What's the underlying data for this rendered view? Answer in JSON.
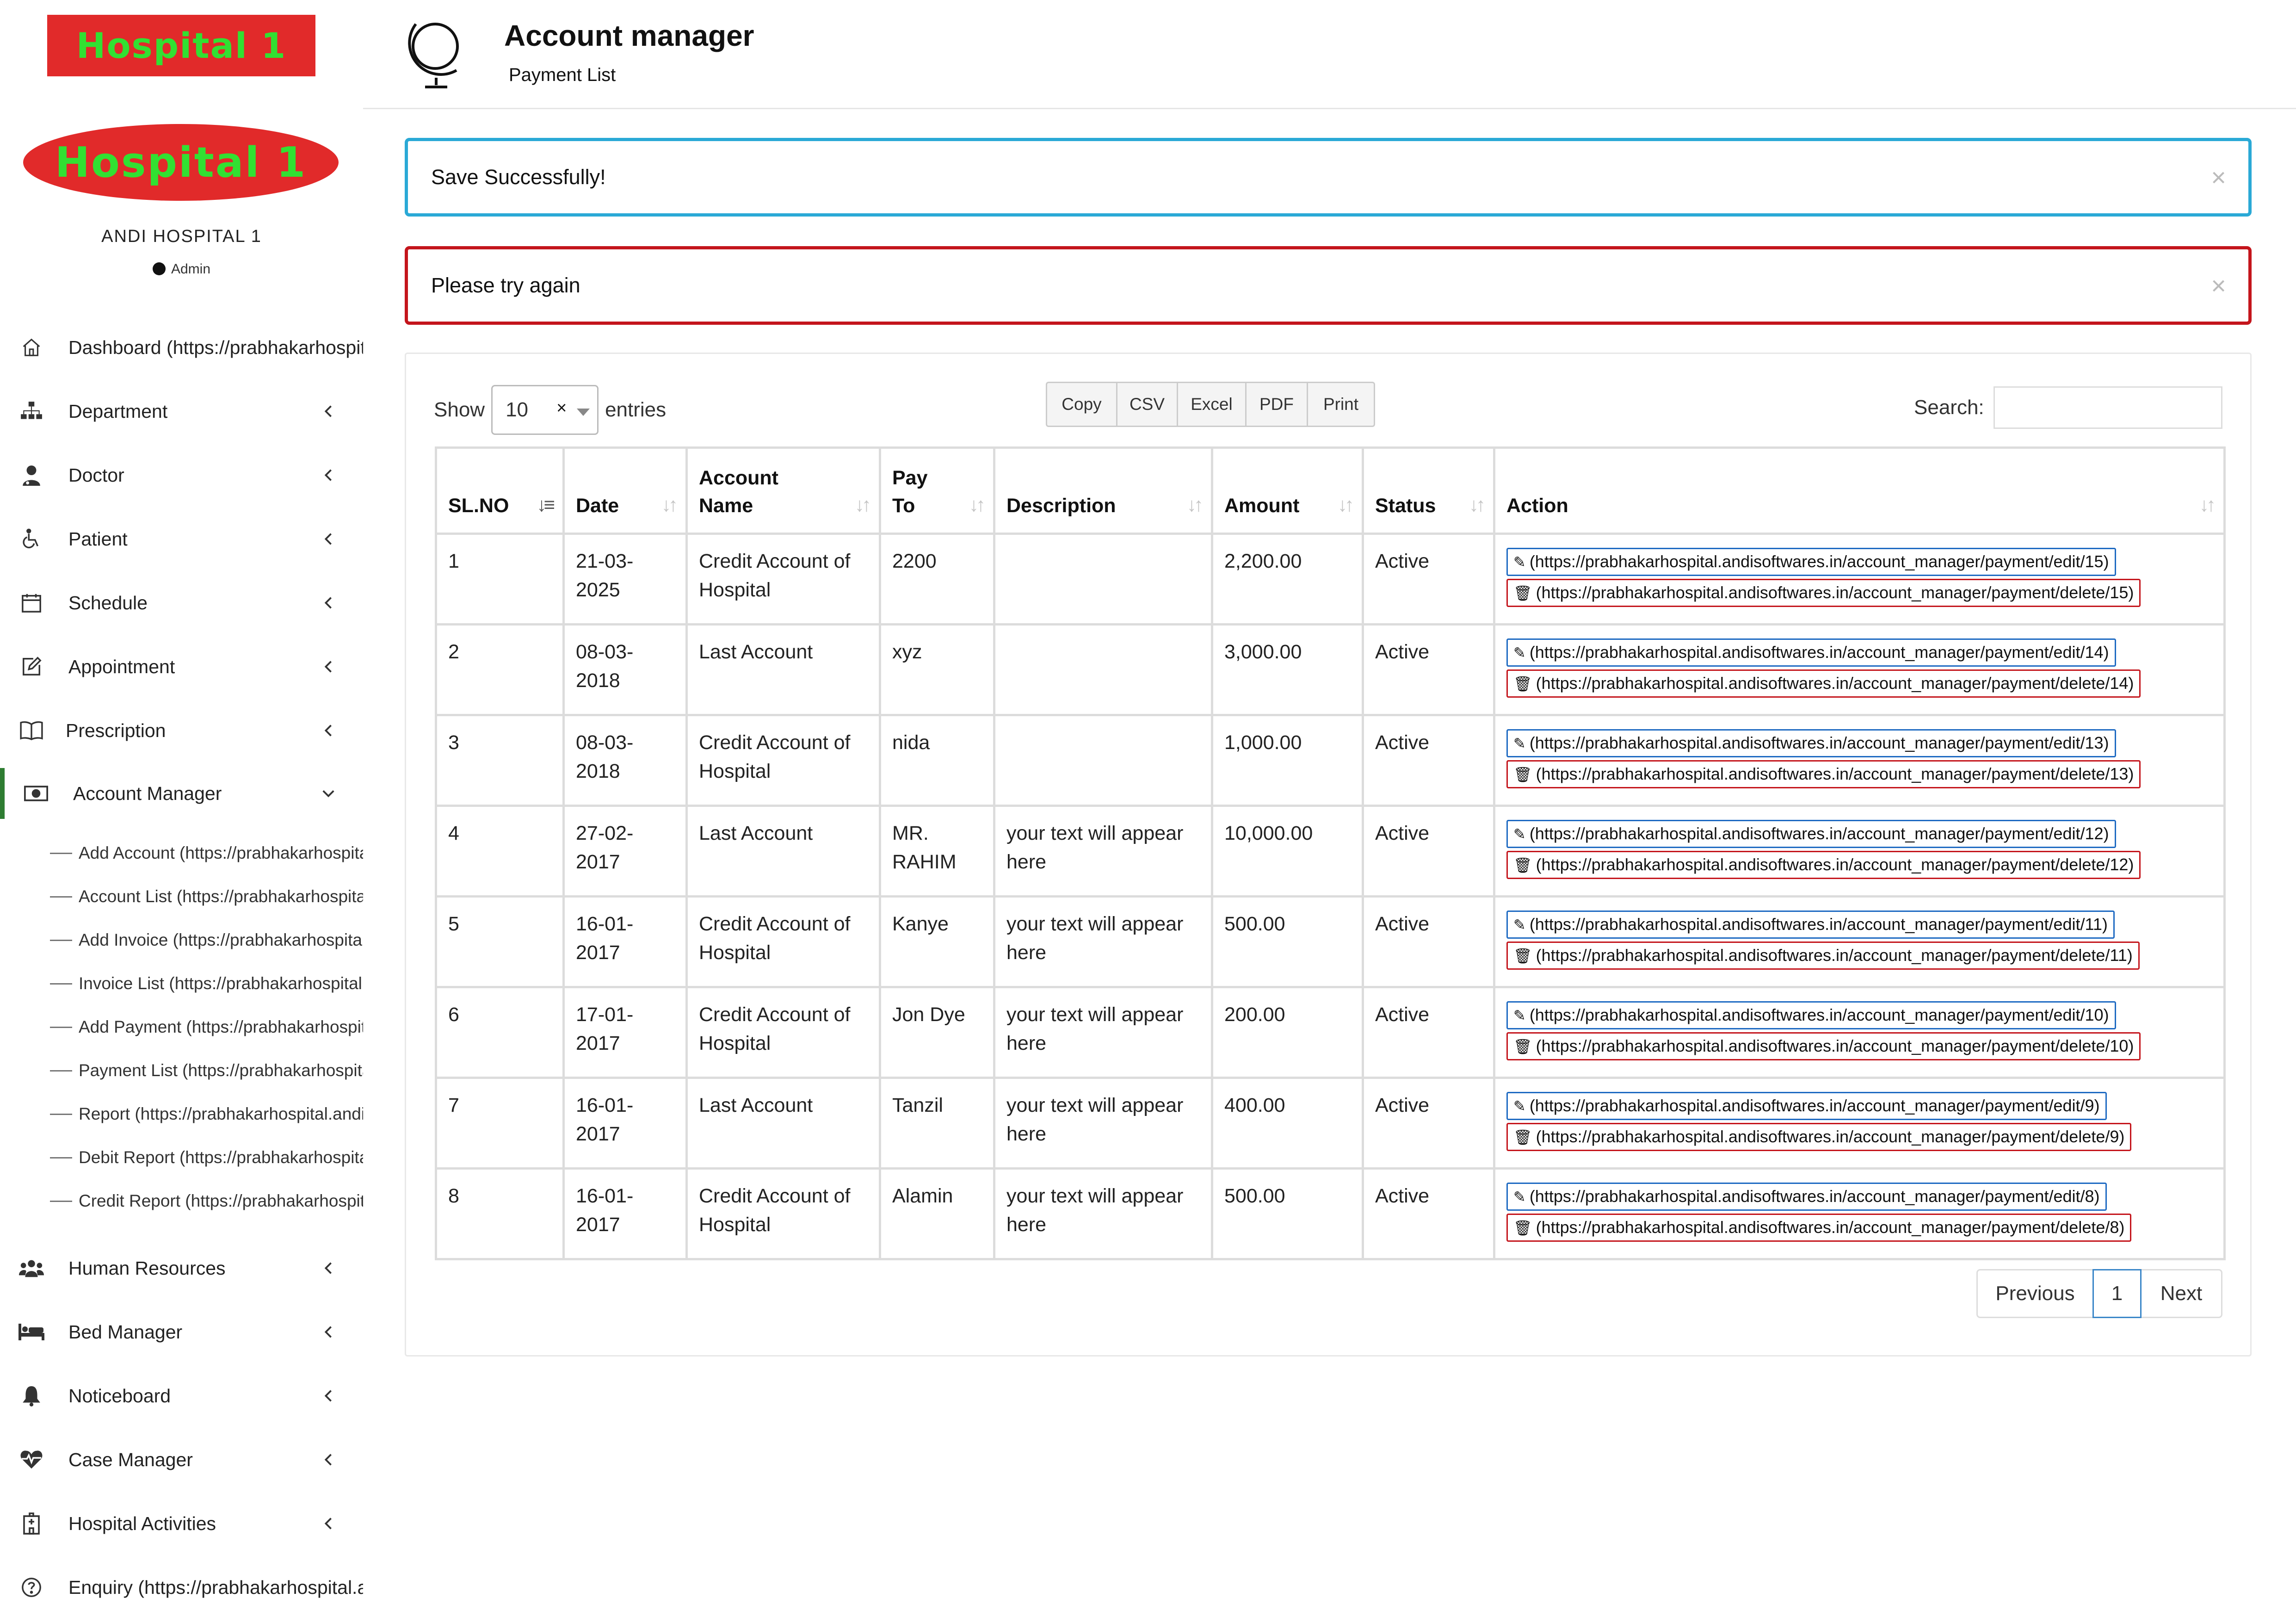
{
  "sidebar": {
    "logo_top": "Hospital 1",
    "logo_oval": "Hospital 1",
    "hospital_name": "ANDI HOSPITAL 1",
    "role": "Admin",
    "nav": [
      {
        "label": "Dashboard (https://prabhakarhospital.andisoftwares.in/dashboard)",
        "icon": "home-icon"
      },
      {
        "label": "Department",
        "icon": "sitemap-icon"
      },
      {
        "label": "Doctor",
        "icon": "user-doctor-icon"
      },
      {
        "label": "Patient",
        "icon": "wheelchair-icon"
      },
      {
        "label": "Schedule",
        "icon": "calendar-icon"
      },
      {
        "label": "Appointment",
        "icon": "edit-icon"
      },
      {
        "label": "Prescription",
        "icon": "book-icon"
      },
      {
        "label": "Account Manager",
        "icon": "money-icon"
      }
    ],
    "submenu": [
      "Add Account (https://prabhakarhospital.andisoftwares.in/account_manager/account/form)",
      "Account List (https://prabhakarhospital.andisoftwares.in/account_manager/account/index)",
      "Add Invoice (https://prabhakarhospital.andisoftwares.in/account_manager/invoice/form)",
      "Invoice List (https://prabhakarhospital.andisoftwares.in/account_manager/invoice/index)",
      "Add Payment (https://prabhakarhospital.andisoftwares.in/account_manager/payment/form)",
      "Payment List (https://prabhakarhospital.andisoftwares.in/account_manager/payment/index)",
      "Report (https://prabhakarhospital.andisoftwares.in/account_manager/report)",
      "Debit Report (https://prabhakarhospital.andisoftwares.in/account_manager/report/debit)",
      "Credit Report (https://prabhakarhospital.andisoftwares.in/account_manager/report/credit)"
    ],
    "nav2": [
      {
        "label": "Human Resources",
        "icon": "users-icon"
      },
      {
        "label": "Bed Manager",
        "icon": "bed-icon"
      },
      {
        "label": "Noticeboard",
        "icon": "bell-icon"
      },
      {
        "label": "Case Manager",
        "icon": "heartbeat-icon"
      },
      {
        "label": "Hospital Activities",
        "icon": "hospital-icon"
      },
      {
        "label": "Enquiry (https://prabhakarhospital.andisoftwares.in/enquiry)",
        "icon": "question-circle-icon"
      }
    ]
  },
  "header": {
    "title": "Account manager",
    "subtitle": "Payment List",
    "icon": "globe-icon"
  },
  "alerts": {
    "success": "Save Successfully!",
    "error": "Please try again",
    "close": "×"
  },
  "controls": {
    "show_label": "Show",
    "entries_value": "10",
    "clear": "×",
    "entries_label": "entries",
    "buttons": [
      "Copy",
      "CSV",
      "Excel",
      "PDF",
      "Print"
    ],
    "search_label": "Search:"
  },
  "table": {
    "headers": [
      "SL.NO",
      "Date",
      "Account Name",
      "Pay To",
      "Description",
      "Amount",
      "Status",
      "Action"
    ],
    "rows": [
      {
        "sl": "1",
        "date": "21-03-2025",
        "account": "Credit Account of Hospital",
        "payto": "2200",
        "desc": "",
        "amount": "2,200.00",
        "status": "Active",
        "edit": "(https://prabhakarhospital.andisoftwares.in/account_manager/payment/edit/15)",
        "del": "(https://prabhakarhospital.andisoftwares.in/account_manager/payment/delete/15)"
      },
      {
        "sl": "2",
        "date": "08-03-2018",
        "account": "Last Account",
        "payto": "xyz",
        "desc": "",
        "amount": "3,000.00",
        "status": "Active",
        "edit": "(https://prabhakarhospital.andisoftwares.in/account_manager/payment/edit/14)",
        "del": "(https://prabhakarhospital.andisoftwares.in/account_manager/payment/delete/14)"
      },
      {
        "sl": "3",
        "date": "08-03-2018",
        "account": "Credit Account of Hospital",
        "payto": "nida",
        "desc": "",
        "amount": "1,000.00",
        "status": "Active",
        "edit": "(https://prabhakarhospital.andisoftwares.in/account_manager/payment/edit/13)",
        "del": "(https://prabhakarhospital.andisoftwares.in/account_manager/payment/delete/13)"
      },
      {
        "sl": "4",
        "date": "27-02-2017",
        "account": "Last Account",
        "payto": "MR. RAHIM",
        "desc": "your text will appear here",
        "amount": "10,000.00",
        "status": "Active",
        "edit": "(https://prabhakarhospital.andisoftwares.in/account_manager/payment/edit/12)",
        "del": "(https://prabhakarhospital.andisoftwares.in/account_manager/payment/delete/12)"
      },
      {
        "sl": "5",
        "date": "16-01-2017",
        "account": "Credit Account of Hospital",
        "payto": "Kanye",
        "desc": "your text will appear here",
        "amount": "500.00",
        "status": "Active",
        "edit": "(https://prabhakarhospital.andisoftwares.in/account_manager/payment/edit/11)",
        "del": "(https://prabhakarhospital.andisoftwares.in/account_manager/payment/delete/11)"
      },
      {
        "sl": "6",
        "date": "17-01-2017",
        "account": "Credit Account of Hospital",
        "payto": "Jon Dye",
        "desc": "your text will appear here",
        "amount": "200.00",
        "status": "Active",
        "edit": "(https://prabhakarhospital.andisoftwares.in/account_manager/payment/edit/10)",
        "del": "(https://prabhakarhospital.andisoftwares.in/account_manager/payment/delete/10)"
      },
      {
        "sl": "7",
        "date": "16-01-2017",
        "account": "Last Account",
        "payto": "Tanzil",
        "desc": "your text will appear here",
        "amount": "400.00",
        "status": "Active",
        "edit": "(https://prabhakarhospital.andisoftwares.in/account_manager/payment/edit/9)",
        "del": "(https://prabhakarhospital.andisoftwares.in/account_manager/payment/delete/9)"
      },
      {
        "sl": "8",
        "date": "16-01-2017",
        "account": "Credit Account of Hospital",
        "payto": "Alamin",
        "desc": "your text will appear here",
        "amount": "500.00",
        "status": "Active",
        "edit": "(https://prabhakarhospital.andisoftwares.in/account_manager/payment/edit/8)",
        "del": "(https://prabhakarhospital.andisoftwares.in/account_manager/payment/delete/8)"
      }
    ]
  },
  "pagination": {
    "previous": "Previous",
    "current": "1",
    "next": "Next"
  },
  "colors": {
    "logo_bg": "#e12a2a",
    "logo_text": "#32e032",
    "info_border": "#2aa9d6",
    "danger_border": "#c4151c",
    "active_bar": "#2e7d32",
    "edit_border": "#1e6ac2"
  }
}
